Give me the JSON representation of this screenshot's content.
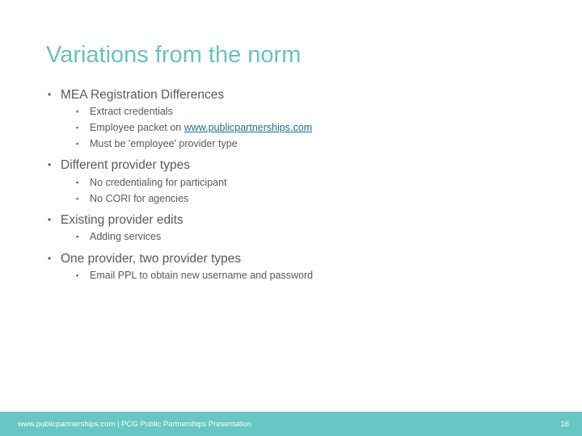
{
  "slide": {
    "title": "Variations from the norm",
    "bullets": [
      {
        "text": "MEA Registration Differences",
        "sub": [
          {
            "text": "Extract credentials"
          },
          {
            "text": "Employee packet on ",
            "link": "www.publicpartnerships.com"
          },
          {
            "text": "Must be 'employee' provider type"
          }
        ]
      },
      {
        "text": "Different provider types",
        "sub": [
          {
            "text": "No credentialing for participant"
          },
          {
            "text": "No CORI for agencies"
          }
        ]
      },
      {
        "text": "Existing provider edits",
        "sub": [
          {
            "text": "Adding services"
          }
        ]
      },
      {
        "text": "One provider, two provider types",
        "sub": [
          {
            "text": "Email PPL to obtain new username and password"
          }
        ]
      }
    ],
    "bullet_glyph": "•",
    "sub_bullet_glyph": "▪"
  },
  "footer": {
    "text": "www.publicpartnerships.com | PCG Public Partnerships Presentation",
    "page_number": "16",
    "color": "#68c6c3"
  },
  "colors": {
    "title": "#6cc0bd",
    "body_text": "#595959",
    "link": "#1f6f8b"
  }
}
